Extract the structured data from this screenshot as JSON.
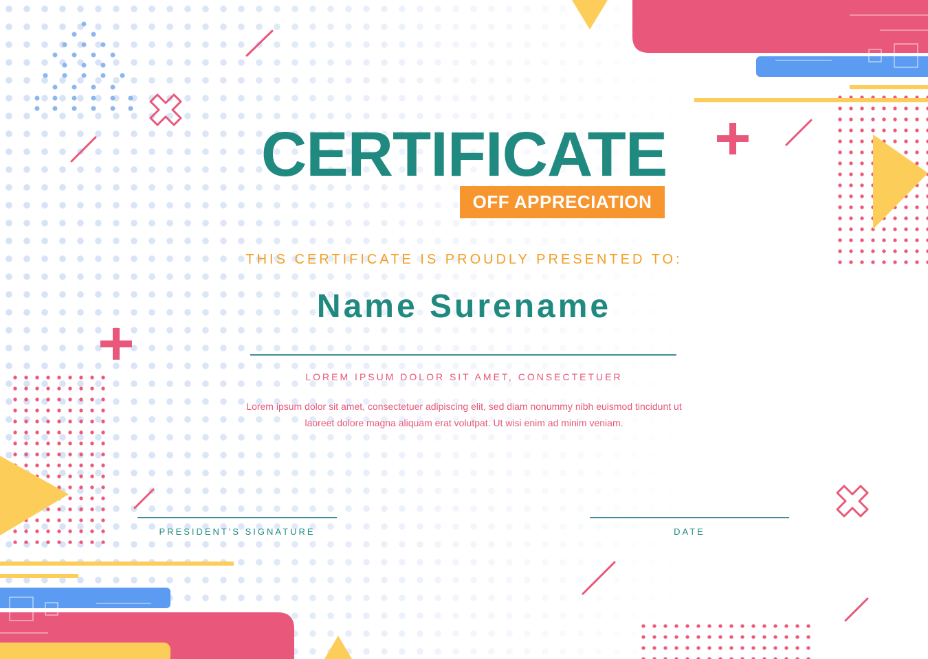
{
  "certificate": {
    "title": "CERTIFICATE",
    "subtitle": "OFF APPRECIATION",
    "presented_text": "THIS CERTIFICATE IS PROUDLY PRESENTED TO:",
    "recipient_name": "Name Surename",
    "lorem_heading": "LOREM IPSUM DOLOR SIT AMET, CONSECTETUER",
    "lorem_body": "Lorem ipsum dolor sit amet, consectetuer adipiscing elit, sed diam nonummy nibh euismod tincidunt ut laoreet dolore magna aliquam erat volutpat. Ut wisi enim ad minim veniam.",
    "signature_label": "PRESIDENT'S SIGNATURE",
    "date_label": "DATE"
  },
  "colors": {
    "teal": "#208a80",
    "orange": "#f7962e",
    "pink": "#e9587a",
    "yellow": "#fdcd59",
    "blue": "#5b9cf2",
    "dot_blue": "#d6e2f6"
  }
}
